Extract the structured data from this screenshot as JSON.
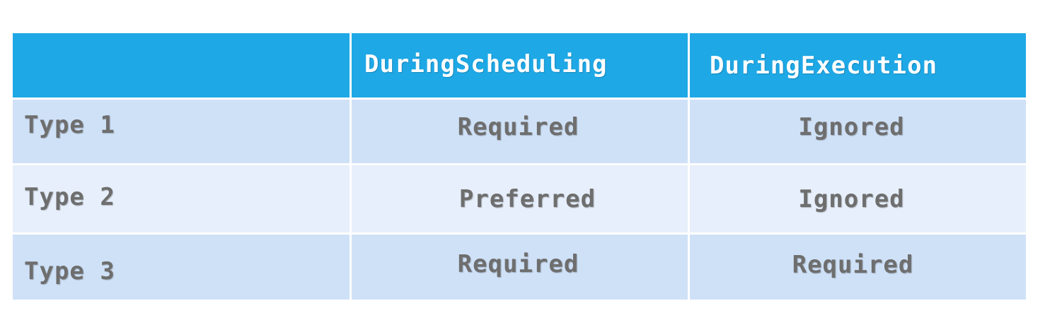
{
  "table": {
    "columns": [
      "",
      "DuringScheduling",
      "DuringExecution"
    ],
    "rows": [
      {
        "label": "Type 1",
        "scheduling": "Required",
        "execution": "Ignored"
      },
      {
        "label": "Type 2",
        "scheduling": "Preferred",
        "execution": "Ignored"
      },
      {
        "label": "Type 3",
        "scheduling": "Required",
        "execution": "Required"
      }
    ]
  },
  "colors": {
    "header": "#1ea8e6",
    "row_odd": "#cfe1f7",
    "row_even": "#e6effb",
    "text": "#6e6e6e"
  }
}
